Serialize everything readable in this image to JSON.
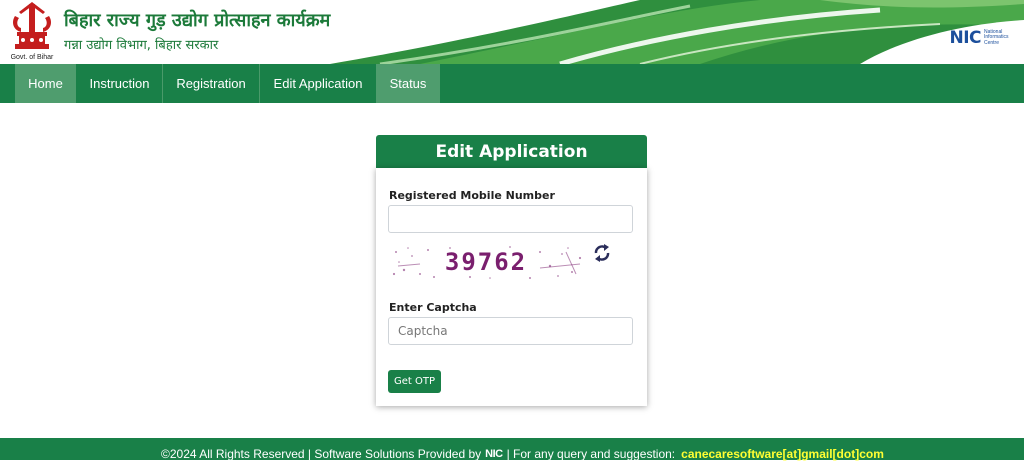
{
  "header": {
    "emblem_caption": "Govt. of Bihar",
    "title": "बिहार राज्य गुड़ उद्योग प्रोत्साहन कार्यक्रम",
    "subtitle": "गन्ना उद्योग विभाग, बिहार सरकार",
    "nic_logo_text": "NIC",
    "nic_logo_full": "National Informatics Centre"
  },
  "nav": {
    "items": [
      {
        "label": "Home",
        "active": true
      },
      {
        "label": "Instruction",
        "active": false
      },
      {
        "label": "Registration",
        "active": false
      },
      {
        "label": "Edit Application",
        "active": false
      },
      {
        "label": "Status",
        "active": true
      }
    ]
  },
  "form": {
    "title": "Edit Application",
    "mobile_label": "Registered Mobile Number",
    "mobile_value": "",
    "captcha_image_text": "39762",
    "captcha_label": "Enter Captcha",
    "captcha_placeholder": "Captcha",
    "submit_label": "Get OTP"
  },
  "footer": {
    "text_before": "©2024 All Rights Reserved | Software Solutions Provided by",
    "nic_text": "NIC",
    "text_after": "| For any query and suggestion:",
    "email": "canecaresoftware[at]gmail[dot]com"
  },
  "colors": {
    "brand_green": "#198048",
    "nav_active": "#4f9d6e",
    "footer_email": "#ffff33",
    "captcha_text": "#7a1f6e"
  }
}
